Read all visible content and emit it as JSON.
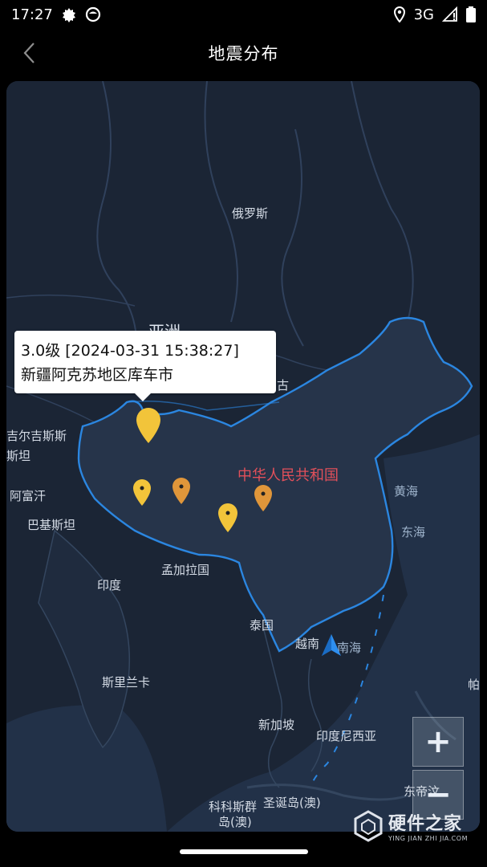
{
  "status": {
    "time": "17:27",
    "network": "3G"
  },
  "header": {
    "title": "地震分布"
  },
  "tooltip": {
    "line1": "3.0级 [2024-03-31 15:38:27]",
    "line2": "新疆阿克苏地区库车市"
  },
  "map_labels": {
    "russia": "俄罗斯",
    "asia": "亚洲",
    "mongolia": "古",
    "kyrgyzstan": "吉尔吉斯斯",
    "tajikistan": "斯坦",
    "afghanistan": "阿富汗",
    "pakistan": "巴基斯坦",
    "china": "中华人民共和国",
    "yellow_sea": "黄海",
    "east_sea": "东海",
    "india": "印度",
    "bangladesh": "孟加拉国",
    "thailand": "泰国",
    "vietnam": "越南",
    "south_sea": "南海",
    "sri_lanka": "斯里兰卡",
    "singapore": "新加坡",
    "indonesia": "印度尼西亚",
    "east_timor": "东帝汶",
    "cocos_islands": "科科斯群",
    "cocos_islands2": "岛(澳)",
    "christmas_island": "圣诞岛(澳)",
    "palau": "帕"
  },
  "zoom": {
    "in": "+",
    "out": "−"
  },
  "watermark": {
    "main": "硬件之家",
    "sub": "YING JIAN ZHI JIA.COM"
  },
  "colors": {
    "map_bg": "#1b2535",
    "border": "#2b86e0",
    "pin_yellow": "#f2c43a",
    "pin_orange": "#e0963a"
  }
}
